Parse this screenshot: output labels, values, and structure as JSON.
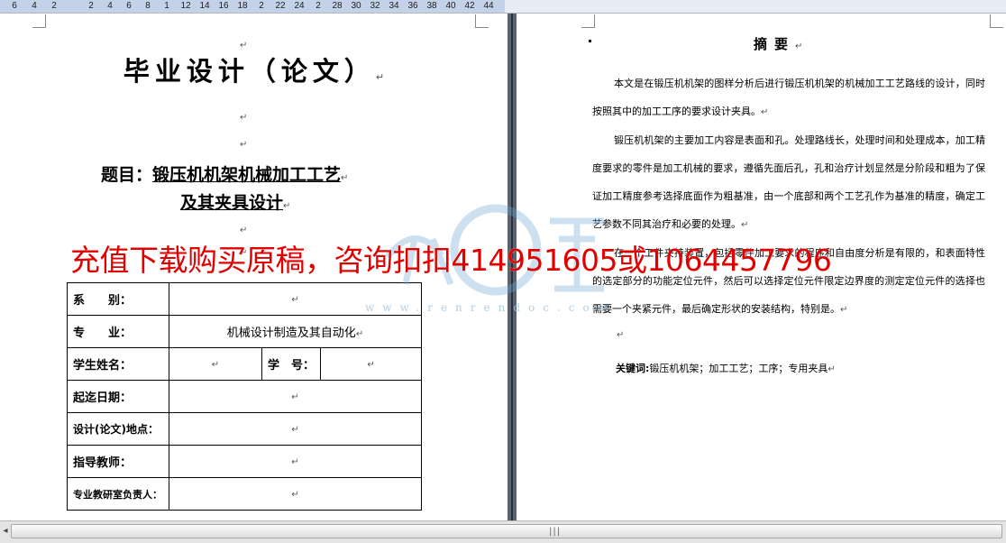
{
  "ruler": {
    "labels": [
      "6",
      "4",
      "2",
      "2",
      "4",
      "6",
      "8",
      "1",
      "12",
      "14",
      "16",
      "18",
      "2",
      "22",
      "24",
      "2",
      "28",
      "30",
      "32",
      "34",
      "36",
      "38",
      "40",
      "42",
      "44"
    ]
  },
  "left_page": {
    "paragraph_mark": "↵",
    "title": "毕业设计（论文）",
    "topic_prefix": "题目：",
    "topic_line1": "锻压机机架机械加工工艺",
    "topic_line2": "及其夹具设计",
    "table": {
      "rows": [
        {
          "label": "系　　别：",
          "value": ""
        },
        {
          "label": "专　　业：",
          "value": "机械设计制造及其自动化"
        },
        {
          "label": "学生姓名：",
          "value": "",
          "label2": "学　号：",
          "value2": ""
        },
        {
          "label": "起迄日期：",
          "value": ""
        },
        {
          "label": "设计(论文)地点：",
          "value": ""
        },
        {
          "label": "指导教师：",
          "value": ""
        },
        {
          "label": "专业教研室负责人：",
          "value": ""
        }
      ]
    }
  },
  "watermark": {
    "text": "充值下载购买原稿，咨询扣扣414951605或1064457796",
    "site": "www.renrendoc.com",
    "logo_text": "人人文库",
    "color": "#e00000"
  },
  "right_page": {
    "title": "摘要",
    "paragraphs": [
      "本文是在锻压机机架的图样分析后进行锻压机机架的机械加工工艺路线的设计，同时按照其中的加工工序的要求设计夹具。",
      "锻压机机架的主要加工内容是表面和孔。处理路线长，处理时间和处理成本，加工精度要求的零件是加工机械的要求，遵循先面后孔，孔和治疗计划显然是分阶段和粗为了保证加工精度参考选择底面作为粗基准，由一个底部和两个工艺孔作为基准的精度，确定工艺参数不同其治疗和必要的处理。",
      "在一个工件夹持装置，包括零件加工要求的程序和自由度分析是有限的，和表面特性的选定部分的功能定位元件，然后可以选择定位元件限定边界度的测定定位元件的选择也需要一个夹紧元件，最后确定形状的安装结构，特别是。"
    ],
    "keywords_label": "关键词",
    "keywords": "锻压机机架；加工工艺；工序；专用夹具"
  },
  "scrollbar": {
    "grip": "|||"
  }
}
